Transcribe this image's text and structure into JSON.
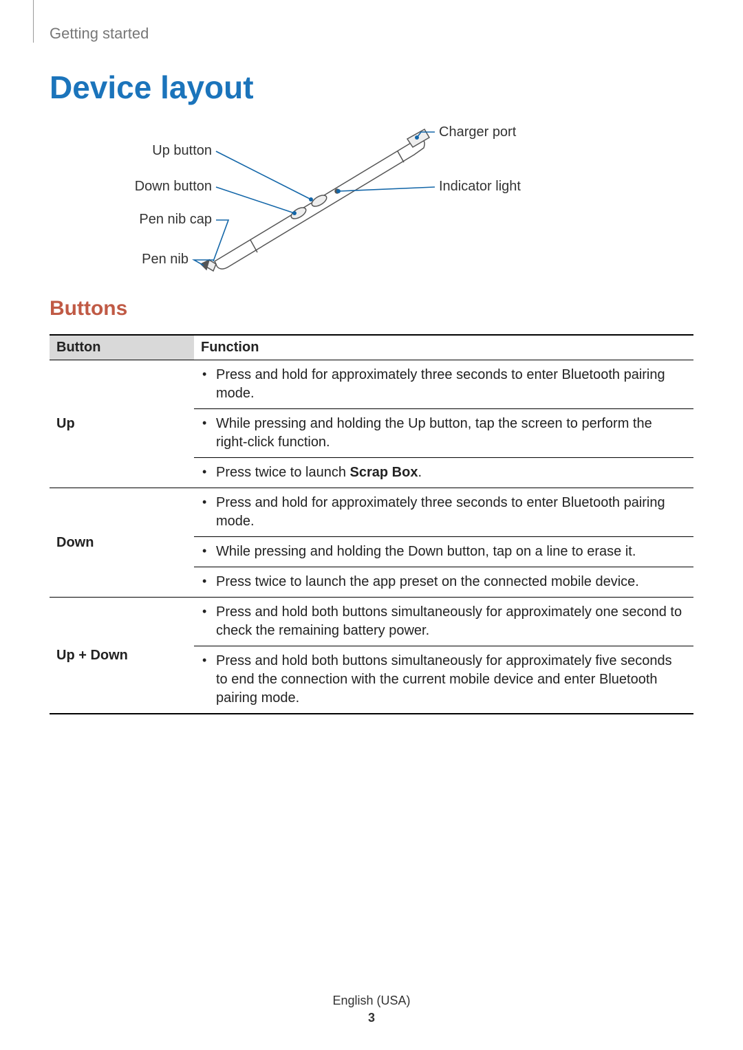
{
  "section": "Getting started",
  "h1": "Device layout",
  "h2": "Buttons",
  "diagram": {
    "labels": {
      "up": "Up button",
      "down": "Down button",
      "cap": "Pen nib cap",
      "nib": "Pen nib",
      "charger": "Charger port",
      "indicator": "Indicator light"
    }
  },
  "table": {
    "headers": {
      "button": "Button",
      "function": "Function"
    },
    "rows": [
      {
        "button": "Up",
        "items": [
          {
            "text": "Press and hold for approximately three seconds to enter Bluetooth pairing mode."
          },
          {
            "text": "While pressing and holding the Up button, tap the screen to perform the right-click function."
          },
          {
            "prefix": "Press twice to launch ",
            "bold": "Scrap Box",
            "suffix": "."
          }
        ]
      },
      {
        "button": "Down",
        "items": [
          {
            "text": "Press and hold for approximately three seconds to enter Bluetooth pairing mode."
          },
          {
            "text": "While pressing and holding the Down button, tap on a line to erase it."
          },
          {
            "text": "Press twice to launch the app preset on the connected mobile device."
          }
        ]
      },
      {
        "button": "Up + Down",
        "items": [
          {
            "text": "Press and hold both buttons simultaneously for approximately one second to check the remaining battery power."
          },
          {
            "text": "Press and hold both buttons simultaneously for approximately five seconds to end the connection with the current mobile device and enter Bluetooth pairing mode."
          }
        ]
      }
    ]
  },
  "footer": {
    "lang": "English (USA)",
    "page": "3"
  }
}
